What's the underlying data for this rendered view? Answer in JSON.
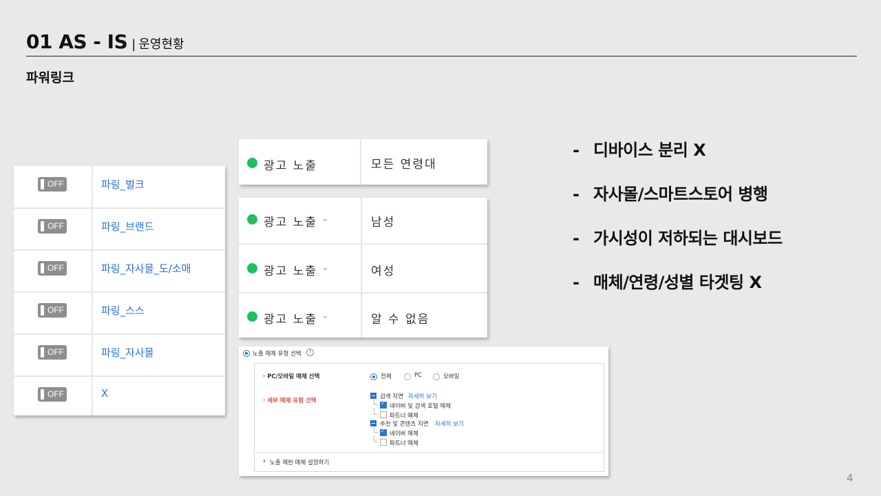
{
  "header": {
    "title": "01 AS - IS",
    "separator": "|",
    "subtitle": "운영현황"
  },
  "section_title": "파워링크",
  "toggles": {
    "off_label": "OFF",
    "items": [
      "파링_벌크",
      "파링_브랜드",
      "파링_자사몰_도/소매",
      "파링_스스",
      "파링_자사몰",
      "X"
    ]
  },
  "exposure_age": {
    "status": "광고 노출",
    "value": "모든 연령대"
  },
  "exposure_gender": {
    "rows": [
      {
        "status": "광고 노출",
        "value": "남성"
      },
      {
        "status": "광고 노출",
        "value": "여성"
      },
      {
        "status": "광고 노출",
        "value": "알 수 없음"
      }
    ]
  },
  "bullets": {
    "dash": "-",
    "items": [
      "디바이스 분리 X",
      "자사몰/스마트스토어 병행",
      "가시성이 저하되는 대시보드",
      "매체/연령/성별 타겟팅 X"
    ]
  },
  "settings": {
    "header": "노출 매체 유형 선택",
    "pc_mobile_label": "· PC/모바일 매체 선택",
    "pc_mobile_options": [
      "전체",
      "PC",
      "모바일"
    ],
    "detail_label": "· 세부 매체 유형 선택",
    "search_group": "검색 지면",
    "search_link": "자세히 보기",
    "search_children": [
      "네이버 및 검색 포털 매체",
      "파트너 매체"
    ],
    "recommend_group": "추천 및 콘텐츠 지면",
    "recommend_link": "자세히 보기",
    "recommend_children": [
      "네이버 매체",
      "파트너 매체"
    ],
    "exclude_label": "노출 제한 매체 설정하기"
  },
  "page_number": "4"
}
